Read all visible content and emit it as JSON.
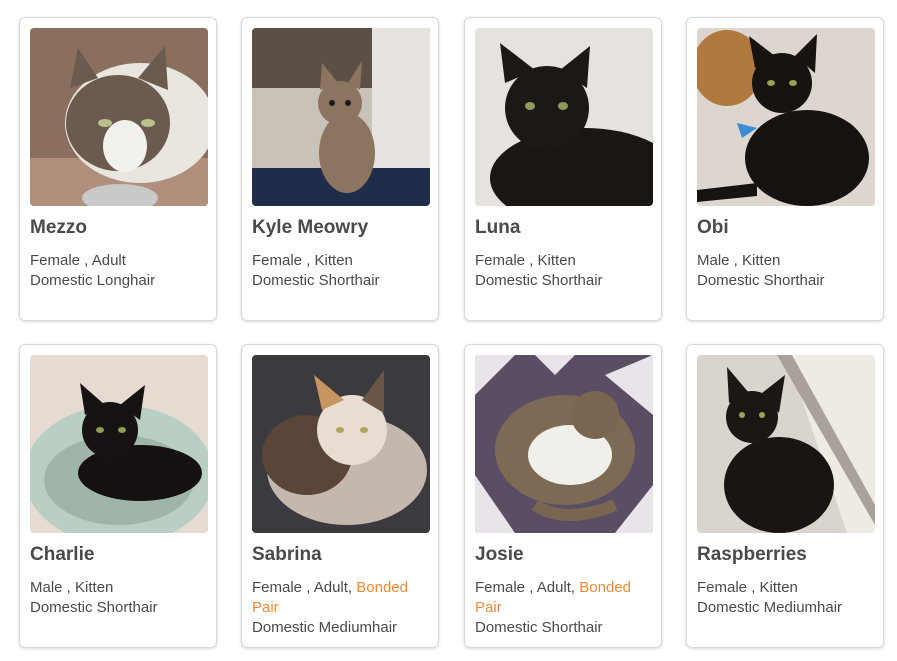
{
  "accent_color": "#ef8a3a",
  "text_color": "#4a4a4a",
  "cats": [
    {
      "name": "Mezzo",
      "sex": "Female",
      "age": "Adult",
      "bonded": "",
      "breed": "Domestic Longhair",
      "photo_alt": "tabby and white longhair cat"
    },
    {
      "name": "Kyle Meowry",
      "sex": "Female",
      "age": "Kitten",
      "bonded": "",
      "breed": "Domestic Shorthair",
      "photo_alt": "tabby kitten"
    },
    {
      "name": "Luna",
      "sex": "Female",
      "age": "Kitten",
      "bonded": "",
      "breed": "Domestic Shorthair",
      "photo_alt": "black kitten"
    },
    {
      "name": "Obi",
      "sex": "Male",
      "age": "Kitten",
      "bonded": "",
      "breed": "Domestic Shorthair",
      "photo_alt": "black kitten"
    },
    {
      "name": "Charlie",
      "sex": "Male",
      "age": "Kitten",
      "bonded": "",
      "breed": "Domestic Shorthair",
      "photo_alt": "black kitten in bed"
    },
    {
      "name": "Sabrina",
      "sex": "Female",
      "age": "Adult,",
      "bonded": "Bonded Pair",
      "breed": "Domestic Mediumhair",
      "photo_alt": "dilute calico cat"
    },
    {
      "name": "Josie",
      "sex": "Female",
      "age": "Adult,",
      "bonded": "Bonded Pair",
      "breed": "Domestic Shorthair",
      "photo_alt": "tabby and white cat curled up"
    },
    {
      "name": "Raspberries",
      "sex": "Female",
      "age": "Kitten",
      "bonded": "",
      "breed": "Domestic Mediumhair",
      "photo_alt": "black fluffy kitten"
    }
  ]
}
